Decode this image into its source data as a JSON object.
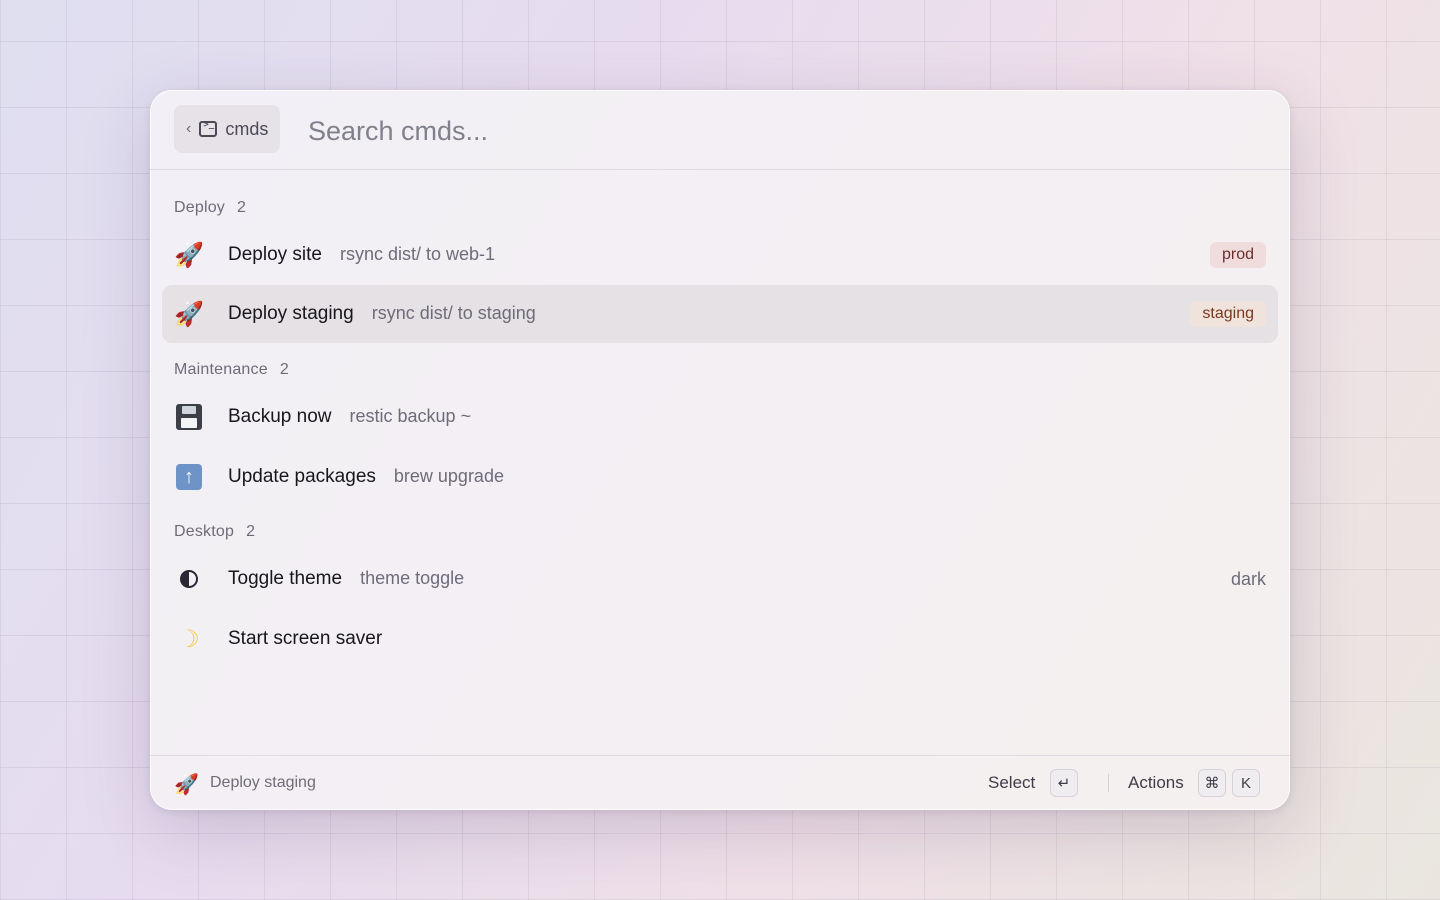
{
  "search": {
    "scope_label": "cmds",
    "placeholder": "Search cmds..."
  },
  "sections": [
    {
      "title": "Deploy",
      "count": "2",
      "items": [
        {
          "icon": "rocket-icon",
          "title": "Deploy site",
          "subtitle": "rsync dist/ to web-1",
          "badge": "prod",
          "selected": false
        },
        {
          "icon": "rocket-icon",
          "title": "Deploy staging",
          "subtitle": "rsync dist/ to staging",
          "badge": "staging",
          "selected": true
        }
      ]
    },
    {
      "title": "Maintenance",
      "count": "2",
      "items": [
        {
          "icon": "floppy-disk-icon",
          "title": "Backup now",
          "subtitle": "restic backup ~"
        },
        {
          "icon": "up-arrow-icon",
          "title": "Update packages",
          "subtitle": "brew upgrade"
        }
      ]
    },
    {
      "title": "Desktop",
      "count": "2",
      "items": [
        {
          "icon": "half-circle-icon",
          "title": "Toggle theme",
          "subtitle": "theme toggle",
          "accessory": "dark"
        },
        {
          "icon": "moon-icon",
          "title": "Start screen saver",
          "subtitle": ""
        }
      ]
    }
  ],
  "footer": {
    "icon": "rocket-icon",
    "selected_title": "Deploy staging",
    "primary_action_label": "Select",
    "primary_action_key": "↵",
    "actions_label": "Actions",
    "actions_keys": [
      "⌘",
      "K"
    ]
  },
  "colors": {
    "selected_row": "#e5e1e4",
    "prod_badge_bg": "#f0dcdc",
    "staging_badge_bg": "#efe3dc"
  }
}
